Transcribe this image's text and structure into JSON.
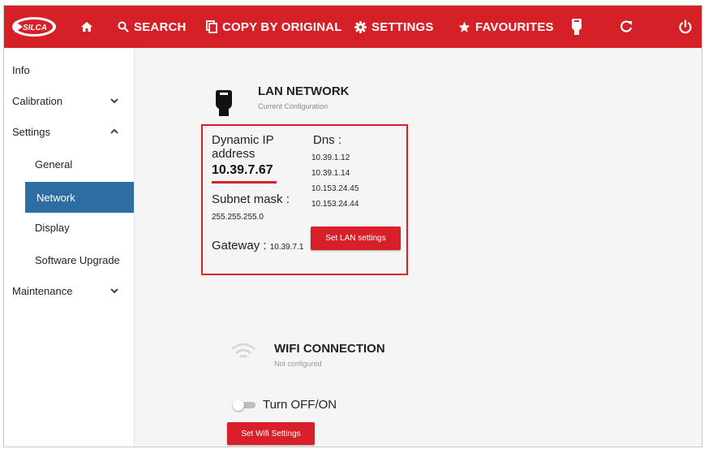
{
  "topbar": {
    "logo_text": "SILCA",
    "items": [
      {
        "label": "SEARCH",
        "icon": "search-icon"
      },
      {
        "label": "COPY BY ORIGINAL",
        "icon": "copy-icon"
      },
      {
        "label": "SETTINGS",
        "icon": "gear-icon"
      },
      {
        "label": "FAVOURITES",
        "icon": "star-icon"
      }
    ],
    "icons": [
      "home-icon",
      "ethernet-icon",
      "refresh-icon",
      "power-icon"
    ],
    "color": "#d62028"
  },
  "sidebar": {
    "items": [
      {
        "label": "Info"
      },
      {
        "label": "Calibration",
        "chevron": "down"
      },
      {
        "label": "Settings",
        "chevron": "up"
      },
      {
        "label": "General"
      },
      {
        "label": "Network",
        "active": true
      },
      {
        "label": "Display"
      },
      {
        "label": "Software Upgrade"
      },
      {
        "label": "Maintenance",
        "chevron": "down"
      }
    ],
    "active_color": "#2e6da4"
  },
  "lan": {
    "title": "LAN NETWORK",
    "subtitle": "Current Configuration",
    "dynamic_ip_label": "Dynamic IP address",
    "ip": "10.39.7.67",
    "subnet_label": "Subnet mask :",
    "subnet": "255.255.255.0",
    "gateway_label": "Gateway :",
    "gateway": "10.39.7.1",
    "dns_label": "Dns :",
    "dns": [
      "10.39.1.12",
      "10.39.1.14",
      "10.153.24.45",
      "10.153.24.44"
    ],
    "button": "Set LAN settings"
  },
  "wifi": {
    "title": "WIFI CONNECTION",
    "subtitle": "Not configured",
    "toggle_label": "Turn OFF/ON",
    "toggle_on": false,
    "button": "Set Wifi Settings"
  },
  "accent_color": "#d81f2a"
}
